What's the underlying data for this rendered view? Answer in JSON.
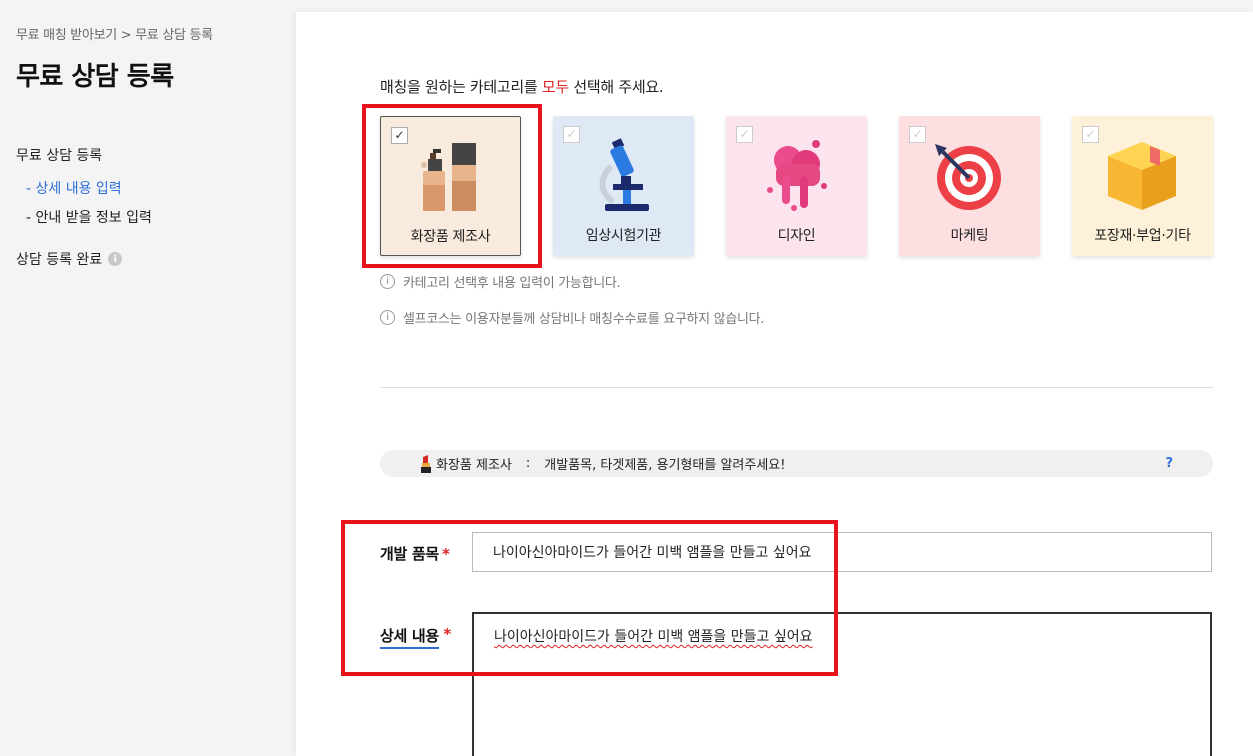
{
  "sidebar": {
    "breadcrumb": "무료 매칭 받아보기 > 무료 상담 등록",
    "title": "무료 상담 등록",
    "nav_main": "무료 상담 등록",
    "nav_sub_1": "- 상세 내용 입력",
    "nav_sub_2": "- 안내 받을 정보 입력",
    "nav_done": "상담 등록 완료",
    "info_icon": "i"
  },
  "main": {
    "instruction_prefix": "매칭을 원하는 카테고리를 ",
    "instruction_accent": "모두",
    "instruction_suffix": " 선택해 주세요.",
    "categories": [
      {
        "label": "화장품 제조사",
        "icon": "cosmetics-bottles-icon",
        "bg": "#f8ebdd",
        "checked": true
      },
      {
        "label": "임상시험기관",
        "icon": "microscope-icon",
        "bg": "#dfe9f6",
        "checked": false
      },
      {
        "label": "디자인",
        "icon": "paint-splash-icon",
        "bg": "#fce4ee",
        "checked": false
      },
      {
        "label": "마케팅",
        "icon": "target-dart-icon",
        "bg": "#fddfe1",
        "checked": false
      },
      {
        "label": "포장재·부업·기타",
        "icon": "box-icon",
        "bg": "#fdf1d9",
        "checked": false
      }
    ],
    "check_mark": "✓",
    "note_1": "카테고리 선택후 내용 입력이 가능합니다.",
    "note_2": "셀프코스는 이용자분들께 상담비나 매칭수수료를 요구하지 않습니다.",
    "note_icon": "i",
    "hint": {
      "category": "화장품 제조사",
      "separator": ":",
      "text": "개발품목, 타겟제품, 용기형태를 알려주세요!",
      "help": "?"
    },
    "field_1_label": "개발 품목",
    "field_1_value": "나이아신아마이드가 들어간 미백 앰플을 만들고 싶어요",
    "field_2_label": "상세 내용",
    "field_2_value": "나이아신아마이드가 들어간 미백 앰플을 만들고 싶어요",
    "required_mark": "*"
  },
  "colors": {
    "accent_red": "#e02020",
    "highlight_red": "#e8141c",
    "link_blue": "#2e6fd8"
  }
}
